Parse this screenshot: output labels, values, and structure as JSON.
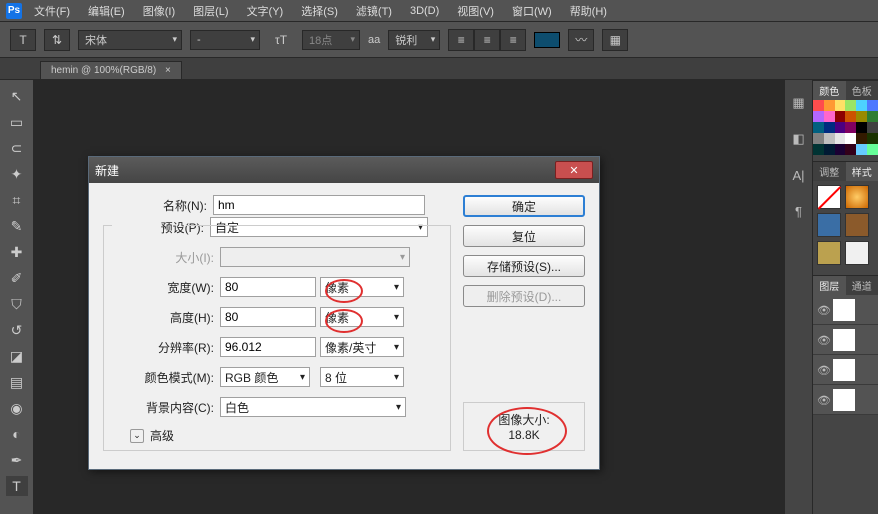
{
  "app_logo": "Ps",
  "menus": [
    "文件(F)",
    "编辑(E)",
    "图像(I)",
    "图层(L)",
    "文字(Y)",
    "选择(S)",
    "滤镜(T)",
    "3D(D)",
    "视图(V)",
    "窗口(W)",
    "帮助(H)"
  ],
  "options": {
    "font_family": "宋体",
    "font_style": "-",
    "font_size": "18点",
    "aa": "锐利",
    "aa_icon": "aa"
  },
  "tab_title": "hemin @ 100%(RGB/8)",
  "dialog": {
    "title": "新建",
    "name_label": "名称(N):",
    "name_value": "hm",
    "preset_label": "预设(P):",
    "preset_value": "自定",
    "size_label": "大小(I):",
    "size_value": "",
    "width_label": "宽度(W):",
    "width_value": "80",
    "width_unit": "像素",
    "height_label": "高度(H):",
    "height_value": "80",
    "height_unit": "像素",
    "res_label": "分辨率(R):",
    "res_value": "96.012",
    "res_unit": "像素/英寸",
    "mode_label": "颜色模式(M):",
    "mode_value": "RGB 颜色",
    "mode_bits": "8 位",
    "bg_label": "背景内容(C):",
    "bg_value": "白色",
    "advanced": "高级",
    "ok": "确定",
    "reset": "复位",
    "save_preset": "存储预设(S)...",
    "delete_preset": "删除预设(D)...",
    "imgsize_label": "图像大小:",
    "imgsize_value": "18.8K"
  },
  "panel_tabs": {
    "color": "颜色",
    "swatch": "色板",
    "adjust": "调整",
    "style": "样式",
    "layer": "图层",
    "channel": "通道"
  },
  "swatch_colors": [
    "#ff4d4d",
    "#ff9933",
    "#ffe066",
    "#9be564",
    "#4dd2ff",
    "#4d79ff",
    "#b366ff",
    "#ff66cc",
    "#8b0000",
    "#cc5200",
    "#998a00",
    "#2e7d32",
    "#006080",
    "#002b80",
    "#4b0082",
    "#800060",
    "#000000",
    "#404040",
    "#808080",
    "#bfbfbf",
    "#e6e6e6",
    "#ffffff",
    "#331a00",
    "#1a3300",
    "#003333",
    "#001a33",
    "#1a0033",
    "#33001a",
    "#66ccff",
    "#66ff99"
  ],
  "style_cells": [
    "none",
    "orange",
    "blue",
    "brown",
    "gold",
    "white"
  ]
}
